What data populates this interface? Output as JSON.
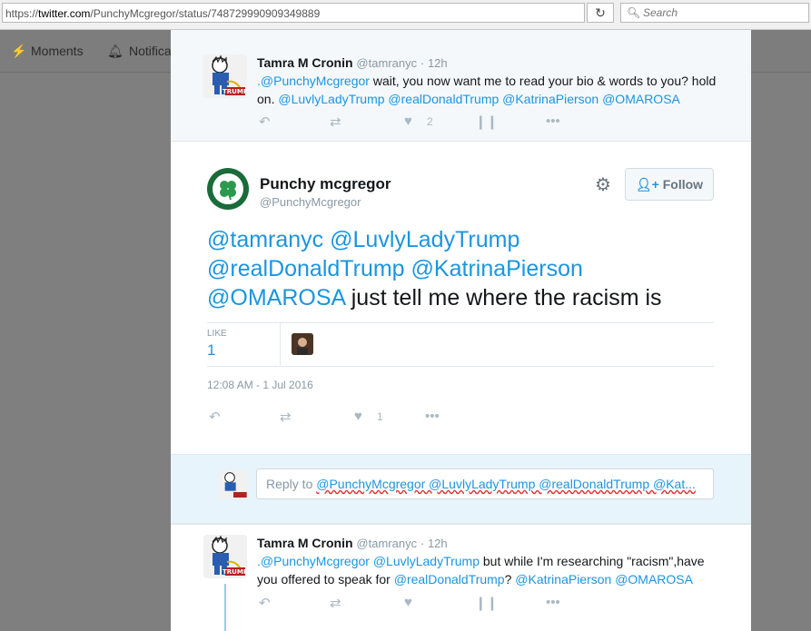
{
  "browser": {
    "url_prefix": "https://",
    "url_domain": "twitter.com",
    "url_path": "/PunchyMcgregor/status/748729990909349889",
    "refresh_icon": "refresh-icon",
    "search_placeholder": "Search"
  },
  "twitter_nav": {
    "moments": "Moments",
    "notifications": "Notificati"
  },
  "top_tweet": {
    "name": "Tamra M Cronin",
    "handle": "@tamranyc",
    "time": "12h",
    "text_mention": ".@PunchyMcgregor",
    "text_1": " wait, you now want me to read your bio & words to you? hold on. ",
    "mentions": "@LuvlyLadyTrump @realDonaldTrump @KatrinaPierson @OMAROSA",
    "like_count": "2"
  },
  "main_tweet": {
    "name": "Punchy mcgregor",
    "handle": "@PunchyMcgregor",
    "follow_label": "Follow",
    "text_mentions": "@tamranyc @LuvlyLadyTrump @realDonaldTrump @KatrinaPierson @OMAROSA",
    "text_plain": " just tell me where the racism is",
    "like_label": "LIKE",
    "like_value": "1",
    "timestamp": "12:08 AM - 1 Jul 2016",
    "action_like_count": "1"
  },
  "reply": {
    "prefix": "Reply to ",
    "mentions": "@PunchyMcgregor @LuvlyLadyTrump @realDonaldTrump @Kat..."
  },
  "bottom_tweet": {
    "name": "Tamra M Cronin",
    "handle": "@tamranyc",
    "time": "12h",
    "mention_1": ".@PunchyMcgregor @LuvlyLadyTrump",
    "text_1": " but while I'm researching \"racism\",have you offered to speak for ",
    "mention_2": "@realDonaldTrump",
    "text_2": "? ",
    "mention_3": "@KatrinaPierson @OMAROSA"
  },
  "colors": {
    "link": "#1b95e0",
    "muted": "#8899a6",
    "overlay": "#7f7f7f"
  }
}
